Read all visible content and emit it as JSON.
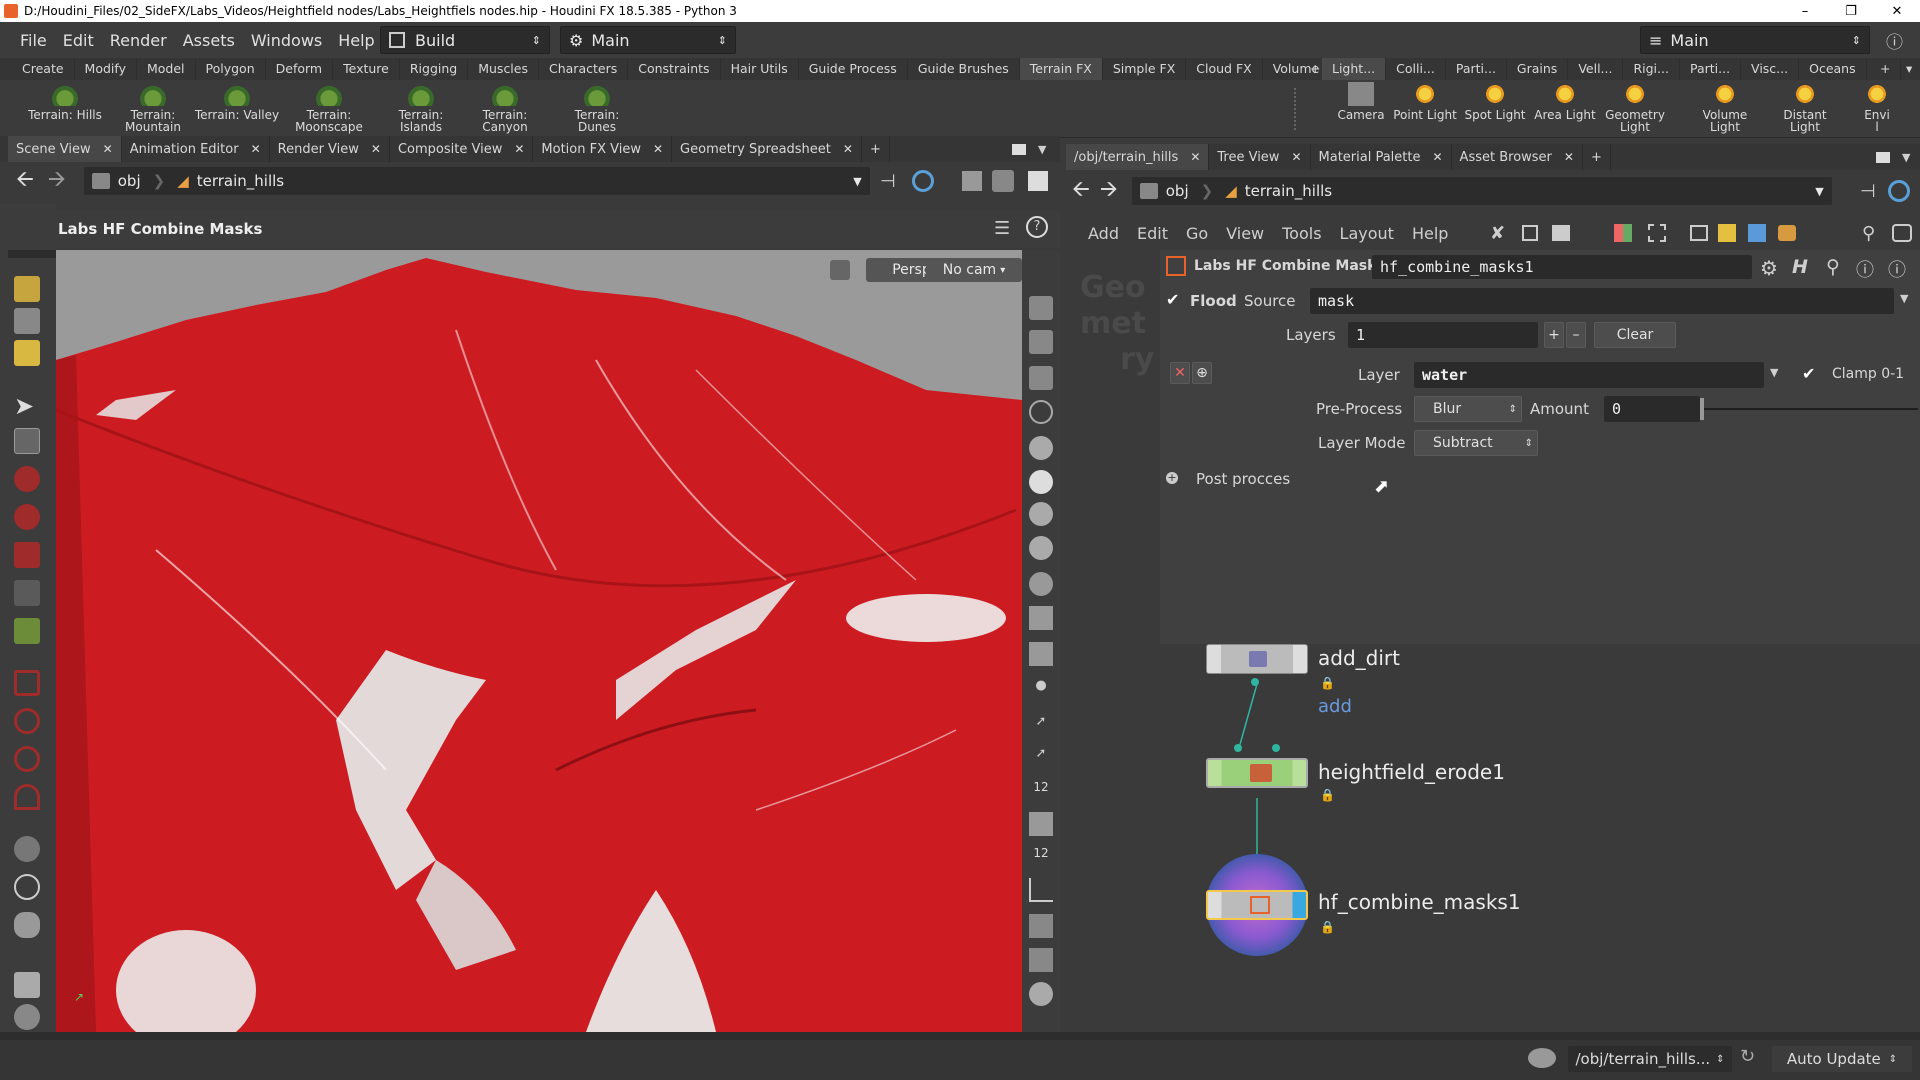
{
  "titlebar": {
    "title": "D:/Houdini_Files/02_SideFX/Labs_Videos/Heightfield nodes/Labs_Heightfiels nodes.hip - Houdini FX 18.5.385 - Python 3"
  },
  "menubar": {
    "items": [
      "File",
      "Edit",
      "Render",
      "Assets",
      "Windows",
      "Help"
    ],
    "desktop_build": "Build",
    "desktop_main": "Main",
    "desktop_main_right": "Main"
  },
  "shelf_tabs_left": [
    "Create",
    "Modify",
    "Model",
    "Polygon",
    "Deform",
    "Texture",
    "Rigging",
    "Muscles",
    "Characters",
    "Constraints",
    "Hair Utils",
    "Guide Process",
    "Guide Brushes",
    "Terrain FX",
    "Simple FX",
    "Cloud FX",
    "Volume"
  ],
  "shelf_tabs_right": [
    "Light...",
    "Colli...",
    "Parti...",
    "Grains",
    "Vell...",
    "Rigi...",
    "Parti...",
    "Visc...",
    "Oceans"
  ],
  "shelf_tools_left": [
    {
      "l1": "Terrain: Hills",
      "l2": ""
    },
    {
      "l1": "Terrain:",
      "l2": "Mountain"
    },
    {
      "l1": "Terrain: Valley",
      "l2": ""
    },
    {
      "l1": "Terrain:",
      "l2": "Moonscape"
    },
    {
      "l1": "Terrain:",
      "l2": "Islands"
    },
    {
      "l1": "Terrain:",
      "l2": "Canyon"
    },
    {
      "l1": "Terrain:",
      "l2": "Dunes"
    }
  ],
  "shelf_tools_right": [
    {
      "l1": "Camera",
      "l2": ""
    },
    {
      "l1": "Point Light",
      "l2": ""
    },
    {
      "l1": "Spot Light",
      "l2": ""
    },
    {
      "l1": "Area Light",
      "l2": ""
    },
    {
      "l1": "Geometry",
      "l2": "Light"
    },
    {
      "l1": "Volume Light",
      "l2": ""
    },
    {
      "l1": "Distant Light",
      "l2": ""
    },
    {
      "l1": "Envi",
      "l2": "l"
    }
  ],
  "left_pane": {
    "tabs": [
      "Scene View",
      "Animation Editor",
      "Render View",
      "Composite View",
      "Motion FX View",
      "Geometry Spreadsheet"
    ],
    "path_obj": "obj",
    "path_node": "terrain_hills",
    "viewer_title": "Labs HF Combine Masks",
    "persp_label": "Persp",
    "cam_label": "No cam"
  },
  "right_pane": {
    "tabs": [
      "/obj/terrain_hills",
      "Tree View",
      "Material Palette",
      "Asset Browser"
    ],
    "path_obj": "obj",
    "path_node": "terrain_hills",
    "menu": [
      "Add",
      "Edit",
      "Go",
      "View",
      "Tools",
      "Layout",
      "Help"
    ],
    "context_watermark": [
      "Geo",
      "met",
      "ry"
    ]
  },
  "params": {
    "node_type": "Labs HF Combine Masks",
    "node_name": "hf_combine_masks1",
    "flood_label": "Flood",
    "source_label": "Source",
    "source_value": "mask",
    "layers_label": "Layers",
    "layers_value": "1",
    "clear_label": "Clear",
    "layer_label": "Layer",
    "layer_value": "water",
    "clamp_label": "Clamp 0-1",
    "preprocess_label": "Pre-Process",
    "preprocess_value": "Blur",
    "amount_label": "Amount",
    "amount_value": "0",
    "layermode_label": "Layer Mode",
    "layermode_value": "Subtract",
    "postprocess_label": "Post procces"
  },
  "network": {
    "nodes": [
      {
        "name": "add_dirt",
        "sublabel": "add"
      },
      {
        "name": "heightfield_erode1",
        "sublabel": ""
      },
      {
        "name": "hf_combine_masks1",
        "sublabel": ""
      }
    ]
  },
  "statusbar": {
    "path": "/obj/terrain_hills...",
    "update_mode": "Auto Update"
  },
  "colors": {
    "terrain_mask": "#cc1c22",
    "selected_node": "#f2c94c",
    "erode_node": "#9ad07a"
  }
}
